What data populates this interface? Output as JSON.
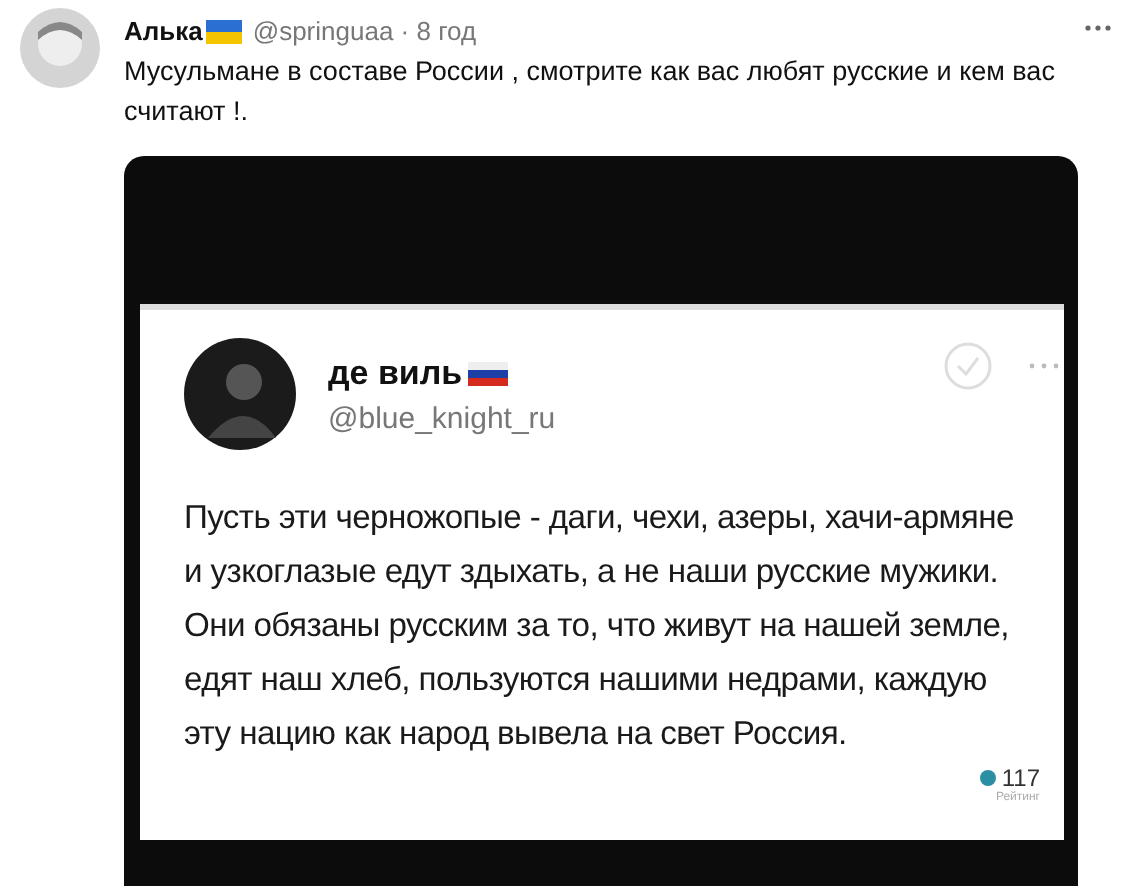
{
  "tweet": {
    "name": "Алька",
    "meta": "@springuaa · 8 год",
    "text": "Мусульмане в составе России , смотрите как вас любят русские и кем вас считают !."
  },
  "embedded_post": {
    "name": "де виль",
    "handle": "@blue_knight_ru",
    "text": "Пусть эти черножопые - даги, чехи, азеры, хачи-армяне и узкоглазые едут здыхать, а не наши русские мужики. Они обязаны русским за то, что живут на нашей земле, едят наш хлеб, пользуются нашими недрами, каждую эту нацию как народ вывела на свет Россия.",
    "rating_count": "117",
    "rating_label": "Рейтинг"
  }
}
